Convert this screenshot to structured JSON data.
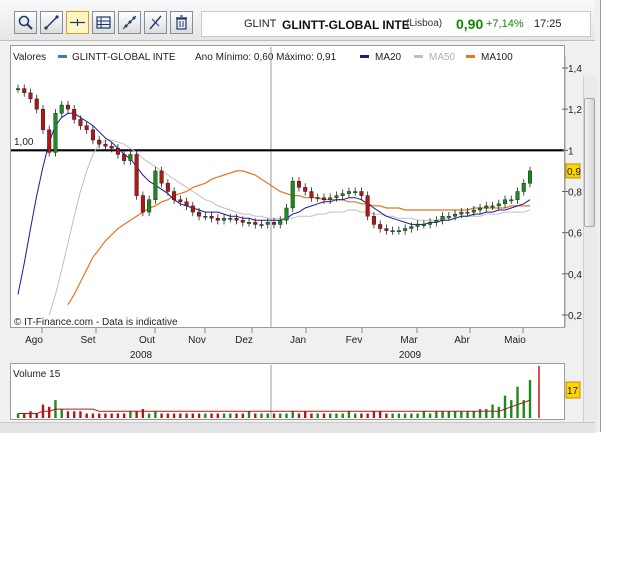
{
  "toolbar": {
    "tools": [
      {
        "icon": "zoom-icon"
      },
      {
        "icon": "trendline-icon"
      },
      {
        "icon": "crosshair-icon"
      },
      {
        "icon": "table-icon"
      },
      {
        "icon": "scatter-icon"
      },
      {
        "icon": "line-tool-icon"
      },
      {
        "icon": "trash-icon"
      }
    ]
  },
  "quote": {
    "ticker": "GLINT",
    "name": "GLINTT-GLOBAL INTE",
    "exchange": "(Lisboa)",
    "price": "0,90",
    "change": "+7,14%",
    "time": "17:25",
    "colors": {
      "price": "#118800",
      "change": "#118800"
    }
  },
  "legend": {
    "valores": "Valores",
    "series_name": "GLINTT-GLOBAL INTE",
    "range": "Ano Mínimo: 0,60 Máximo: 0,91",
    "ma20": "MA20",
    "ma50": "MA50",
    "ma100": "MA100",
    "colors": {
      "price": "#4a7ab0",
      "ma20": "#1a1aa0",
      "ma50": "#c0c0c0",
      "ma100": "#e07820",
      "candle_up": "#1d8a1d",
      "candle_down": "#b01818",
      "hline": "#000000"
    }
  },
  "watermark": "© IT-Finance.com - Data is indicative",
  "hline_label": "1,00",
  "right_axis": {
    "ticks": [
      "1,4",
      "1,2",
      "1",
      "0,8",
      "0,6",
      "0,4",
      "0,2"
    ],
    "price_tag": "0,9"
  },
  "x_axis": {
    "months": [
      "Ago",
      "Set",
      "Out",
      "Nov",
      "Dez",
      "Jan",
      "Fev",
      "Mar",
      "Abr",
      "Maio"
    ],
    "years": [
      "2008",
      "2009"
    ]
  },
  "volume": {
    "title": "Volume 15",
    "tag": "17"
  },
  "chart_data": {
    "type": "line",
    "title": "GLINTT-GLOBAL INTE",
    "ylim": [
      0.2,
      1.4
    ],
    "y_ticks": [
      1.4,
      1.2,
      1.0,
      0.8,
      0.6,
      0.4,
      0.2
    ],
    "hline": 1.0,
    "x_months": [
      "Ago",
      "Set",
      "Out",
      "Nov",
      "Dez",
      "Jan",
      "Fev",
      "Mar",
      "Abr",
      "Maio"
    ],
    "close": [
      1.3,
      1.28,
      1.25,
      1.2,
      1.1,
      0.99,
      1.18,
      1.22,
      1.2,
      1.15,
      1.12,
      1.1,
      1.05,
      1.03,
      1.02,
      1.01,
      0.98,
      0.95,
      0.98,
      0.78,
      0.7,
      0.76,
      0.9,
      0.84,
      0.8,
      0.76,
      0.75,
      0.73,
      0.7,
      0.68,
      0.68,
      0.67,
      0.66,
      0.67,
      0.67,
      0.66,
      0.65,
      0.65,
      0.64,
      0.64,
      0.65,
      0.64,
      0.66,
      0.72,
      0.85,
      0.82,
      0.8,
      0.77,
      0.77,
      0.76,
      0.77,
      0.78,
      0.79,
      0.8,
      0.8,
      0.78,
      0.68,
      0.64,
      0.62,
      0.61,
      0.61,
      0.61,
      0.62,
      0.63,
      0.64,
      0.64,
      0.65,
      0.66,
      0.68,
      0.68,
      0.69,
      0.7,
      0.7,
      0.71,
      0.72,
      0.73,
      0.73,
      0.74,
      0.76,
      0.76,
      0.8,
      0.84,
      0.9
    ],
    "ma20": [
      0.3,
      0.45,
      0.62,
      0.78,
      0.92,
      1.04,
      1.12,
      1.16,
      1.18,
      1.18,
      1.16,
      1.14,
      1.12,
      1.09,
      1.06,
      1.04,
      1.01,
      0.98,
      0.96,
      0.92,
      0.88,
      0.85,
      0.83,
      0.81,
      0.79,
      0.76,
      0.74,
      0.73,
      0.72,
      0.71,
      0.7,
      0.7,
      0.7,
      0.69,
      0.68,
      0.68,
      0.67,
      0.67,
      0.66,
      0.66,
      0.66,
      0.66,
      0.66,
      0.67,
      0.69,
      0.7,
      0.72,
      0.73,
      0.74,
      0.75,
      0.75,
      0.76,
      0.76,
      0.77,
      0.77,
      0.76,
      0.74,
      0.72,
      0.7,
      0.68,
      0.67,
      0.66,
      0.65,
      0.64,
      0.64,
      0.64,
      0.65,
      0.65,
      0.66,
      0.66,
      0.67,
      0.68,
      0.68,
      0.69,
      0.69,
      0.7,
      0.7,
      0.71,
      0.71,
      0.72,
      0.73,
      0.74,
      0.76
    ],
    "ma50": [
      null,
      null,
      null,
      null,
      null,
      0.2,
      0.3,
      0.42,
      0.55,
      0.68,
      0.8,
      0.9,
      0.98,
      1.03,
      1.05,
      1.05,
      1.04,
      1.03,
      1.01,
      0.99,
      0.96,
      0.94,
      0.92,
      0.9,
      0.88,
      0.86,
      0.84,
      0.82,
      0.8,
      0.78,
      0.76,
      0.75,
      0.73,
      0.72,
      0.71,
      0.7,
      0.69,
      0.69,
      0.68,
      0.68,
      0.67,
      0.67,
      0.67,
      0.67,
      0.67,
      0.68,
      0.68,
      0.68,
      0.69,
      0.69,
      0.7,
      0.7,
      0.7,
      0.71,
      0.71,
      0.7,
      0.7,
      0.69,
      0.69,
      0.68,
      0.68,
      0.67,
      0.67,
      0.67,
      0.66,
      0.66,
      0.66,
      0.66,
      0.67,
      0.67,
      0.67,
      0.68,
      0.68,
      0.68,
      0.68,
      0.69,
      0.69,
      0.69,
      0.7,
      0.7,
      0.7,
      0.7,
      0.71
    ],
    "ma100": [
      null,
      null,
      null,
      null,
      null,
      null,
      null,
      null,
      0.25,
      0.3,
      0.36,
      0.42,
      0.48,
      0.52,
      0.56,
      0.59,
      0.62,
      0.64,
      0.66,
      0.68,
      0.7,
      0.72,
      0.73,
      0.75,
      0.76,
      0.78,
      0.79,
      0.8,
      0.82,
      0.83,
      0.84,
      0.86,
      0.87,
      0.88,
      0.89,
      0.9,
      0.9,
      0.89,
      0.88,
      0.86,
      0.84,
      0.82,
      0.8,
      0.79,
      0.78,
      0.78,
      0.77,
      0.77,
      0.77,
      0.76,
      0.76,
      0.76,
      0.76,
      0.75,
      0.75,
      0.74,
      0.74,
      0.73,
      0.73,
      0.72,
      0.72,
      0.72,
      0.71,
      0.71,
      0.71,
      0.71,
      0.71,
      0.71,
      0.71,
      0.71,
      0.71,
      0.71,
      0.71,
      0.72,
      0.72,
      0.72,
      0.72,
      0.72,
      0.72,
      0.73,
      0.73,
      0.73,
      0.73
    ],
    "volume": [
      2,
      2,
      3,
      2,
      6,
      5,
      8,
      4,
      3,
      3,
      3,
      2,
      2,
      2,
      2,
      2,
      2,
      2,
      3,
      3,
      4,
      2,
      3,
      2,
      2,
      2,
      2,
      2,
      2,
      2,
      2,
      2,
      2,
      2,
      2,
      2,
      2,
      3,
      2,
      2,
      2,
      2,
      2,
      2,
      3,
      2,
      3,
      2,
      2,
      2,
      2,
      2,
      2,
      3,
      2,
      2,
      2,
      3,
      3,
      2,
      2,
      2,
      2,
      2,
      2,
      3,
      2,
      3,
      3,
      3,
      3,
      3,
      3,
      3,
      4,
      4,
      6,
      5,
      10,
      8,
      14,
      8,
      17
    ],
    "volume_ma": [
      2,
      2,
      2,
      2,
      3,
      3,
      4,
      4,
      4,
      4,
      4,
      4,
      4,
      3,
      3,
      3,
      3,
      3,
      3,
      3,
      3,
      3,
      3,
      3,
      3,
      3,
      3,
      3,
      3,
      3,
      3,
      3,
      3,
      3,
      3,
      3,
      3,
      3,
      3,
      3,
      3,
      3,
      3,
      3,
      3,
      3,
      3,
      3,
      3,
      3,
      3,
      3,
      3,
      3,
      3,
      3,
      3,
      3,
      3,
      3,
      3,
      3,
      3,
      3,
      3,
      3,
      3,
      3,
      3,
      3,
      3,
      3,
      3,
      3,
      3,
      3,
      3,
      3,
      4,
      5,
      6,
      7,
      8
    ],
    "volume_ylim": [
      0,
      17
    ]
  }
}
